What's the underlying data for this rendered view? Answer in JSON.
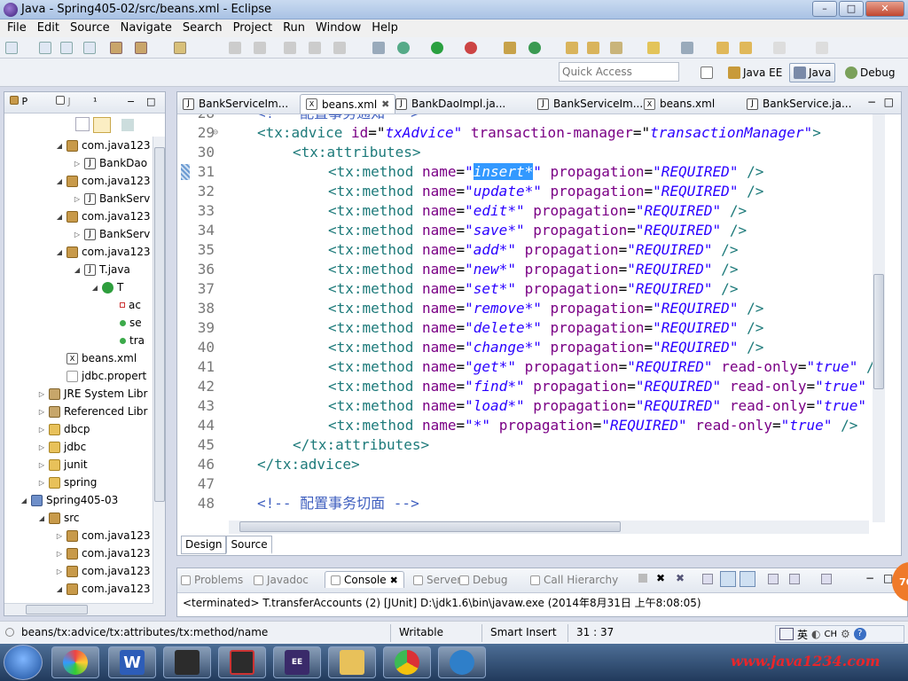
{
  "window": {
    "title": "Java - Spring405-02/src/beans.xml - Eclipse",
    "min": "–",
    "max": "□",
    "close": "✕"
  },
  "menu": [
    "File",
    "Edit",
    "Source",
    "Navigate",
    "Search",
    "Project",
    "Run",
    "Window",
    "Help"
  ],
  "quick_access": {
    "placeholder": "Quick Access"
  },
  "perspectives": [
    {
      "label": "Java EE",
      "active": false
    },
    {
      "label": "Java",
      "active": true
    },
    {
      "label": "Debug",
      "active": false
    }
  ],
  "explorer": {
    "tabs": [
      "P",
      "J",
      "¹"
    ],
    "tree": [
      {
        "label": "com.java123",
        "icon": "package-icon",
        "depth": 2,
        "twisty": "◢"
      },
      {
        "label": "BankDao",
        "icon": "java-file-icon",
        "depth": 3,
        "twisty": "▷"
      },
      {
        "label": "com.java123",
        "icon": "package-icon",
        "depth": 2,
        "twisty": "◢"
      },
      {
        "label": "BankServ",
        "icon": "java-file-icon",
        "depth": 3,
        "twisty": "▷"
      },
      {
        "label": "com.java123",
        "icon": "package-icon",
        "depth": 2,
        "twisty": "◢"
      },
      {
        "label": "BankServ",
        "icon": "java-file-icon",
        "depth": 3,
        "twisty": "▷"
      },
      {
        "label": "com.java123",
        "icon": "package-icon",
        "depth": 2,
        "twisty": "◢"
      },
      {
        "label": "T.java",
        "icon": "java-file-icon",
        "depth": 3,
        "twisty": "◢"
      },
      {
        "label": "T",
        "icon": "class-icon",
        "depth": 4,
        "twisty": "◢"
      },
      {
        "label": "ac",
        "icon": "field-private-icon",
        "depth": 5,
        "twisty": ""
      },
      {
        "label": "se",
        "icon": "method-public-icon",
        "depth": 5,
        "twisty": ""
      },
      {
        "label": "tra",
        "icon": "method-public-icon",
        "depth": 5,
        "twisty": ""
      },
      {
        "label": "beans.xml",
        "icon": "xml-file-icon",
        "depth": 2,
        "twisty": ""
      },
      {
        "label": "jdbc.propert",
        "icon": "properties-file-icon",
        "depth": 2,
        "twisty": ""
      },
      {
        "label": "JRE System Libr",
        "icon": "library-icon",
        "depth": 1,
        "twisty": "▷"
      },
      {
        "label": "Referenced Libr",
        "icon": "library-icon",
        "depth": 1,
        "twisty": "▷"
      },
      {
        "label": "dbcp",
        "icon": "folder-icon",
        "depth": 1,
        "twisty": "▷"
      },
      {
        "label": "jdbc",
        "icon": "folder-icon",
        "depth": 1,
        "twisty": "▷"
      },
      {
        "label": "junit",
        "icon": "folder-icon",
        "depth": 1,
        "twisty": "▷"
      },
      {
        "label": "spring",
        "icon": "folder-icon",
        "depth": 1,
        "twisty": "▷"
      },
      {
        "label": "Spring405-03",
        "icon": "project-icon",
        "depth": 0,
        "twisty": "◢"
      },
      {
        "label": "src",
        "icon": "source-folder-icon",
        "depth": 1,
        "twisty": "◢"
      },
      {
        "label": "com.java123",
        "icon": "package-icon",
        "depth": 2,
        "twisty": "▷"
      },
      {
        "label": "com.java123",
        "icon": "package-icon",
        "depth": 2,
        "twisty": "▷"
      },
      {
        "label": "com.java123",
        "icon": "package-icon",
        "depth": 2,
        "twisty": "▷"
      },
      {
        "label": "com.java123",
        "icon": "package-icon",
        "depth": 2,
        "twisty": "◢"
      }
    ]
  },
  "editor": {
    "tabs": [
      {
        "label": "BankServiceIm...",
        "icon": "java-file-icon",
        "active": false
      },
      {
        "label": "beans.xml",
        "icon": "xml-file-icon",
        "active": true
      },
      {
        "label": "BankDaoImpl.ja...",
        "icon": "java-file-icon",
        "active": false
      },
      {
        "label": "BankServiceIm...",
        "icon": "java-file-icon",
        "active": false
      },
      {
        "label": "beans.xml",
        "icon": "xml-file-icon",
        "active": false
      },
      {
        "label": "BankService.ja...",
        "icon": "java-file-icon",
        "active": false
      }
    ],
    "lines": [
      {
        "n": "28",
        "indent": 0,
        "kind": "comment",
        "text": "<!-- 配置事务通知 -->"
      },
      {
        "n": "29",
        "indent": 0,
        "kind": "open",
        "tag": "tx:advice",
        "attrs": [
          [
            "id",
            "txAdvice"
          ],
          [
            "transaction-manager",
            "transactionManager"
          ]
        ],
        "end": ">",
        "fold": true
      },
      {
        "n": "30",
        "indent": 1,
        "kind": "open",
        "tag": "tx:attributes",
        "attrs": [],
        "end": ">"
      },
      {
        "n": "31",
        "indent": 2,
        "kind": "method",
        "name": "insert*",
        "prop": "REQUIRED",
        "ro": "",
        "selected": true
      },
      {
        "n": "32",
        "indent": 2,
        "kind": "method",
        "name": "update*",
        "prop": "REQUIRED",
        "ro": ""
      },
      {
        "n": "33",
        "indent": 2,
        "kind": "method",
        "name": "edit*",
        "prop": "REQUIRED",
        "ro": ""
      },
      {
        "n": "34",
        "indent": 2,
        "kind": "method",
        "name": "save*",
        "prop": "REQUIRED",
        "ro": ""
      },
      {
        "n": "35",
        "indent": 2,
        "kind": "method",
        "name": "add*",
        "prop": "REQUIRED",
        "ro": ""
      },
      {
        "n": "36",
        "indent": 2,
        "kind": "method",
        "name": "new*",
        "prop": "REQUIRED",
        "ro": ""
      },
      {
        "n": "37",
        "indent": 2,
        "kind": "method",
        "name": "set*",
        "prop": "REQUIRED",
        "ro": ""
      },
      {
        "n": "38",
        "indent": 2,
        "kind": "method",
        "name": "remove*",
        "prop": "REQUIRED",
        "ro": ""
      },
      {
        "n": "39",
        "indent": 2,
        "kind": "method",
        "name": "delete*",
        "prop": "REQUIRED",
        "ro": ""
      },
      {
        "n": "40",
        "indent": 2,
        "kind": "method",
        "name": "change*",
        "prop": "REQUIRED",
        "ro": ""
      },
      {
        "n": "41",
        "indent": 2,
        "kind": "method",
        "name": "get*",
        "prop": "REQUIRED",
        "ro": "true"
      },
      {
        "n": "42",
        "indent": 2,
        "kind": "method",
        "name": "find*",
        "prop": "REQUIRED",
        "ro": "true"
      },
      {
        "n": "43",
        "indent": 2,
        "kind": "method",
        "name": "load*",
        "prop": "REQUIRED",
        "ro": "true"
      },
      {
        "n": "44",
        "indent": 2,
        "kind": "method",
        "name": "*",
        "prop": "REQUIRED",
        "ro": "true"
      },
      {
        "n": "45",
        "indent": 1,
        "kind": "close",
        "tag": "tx:attributes"
      },
      {
        "n": "46",
        "indent": 0,
        "kind": "close",
        "tag": "tx:advice"
      },
      {
        "n": "47",
        "indent": 0,
        "kind": "blank"
      },
      {
        "n": "48",
        "indent": 0,
        "kind": "comment",
        "text": "<!-- 配置事务切面 -->"
      }
    ],
    "design_tabs": [
      "Design",
      "Source"
    ]
  },
  "console": {
    "tabs": [
      {
        "label": "Problems",
        "active": false
      },
      {
        "label": "Javadoc",
        "active": false
      },
      {
        "label": "Console",
        "active": true
      },
      {
        "label": "Servers",
        "active": false
      },
      {
        "label": "Debug",
        "active": false
      },
      {
        "label": "Call Hierarchy",
        "active": false
      }
    ],
    "text": "<terminated> T.transferAccounts (2) [JUnit] D:\\jdk1.6\\bin\\javaw.exe (2014年8月31日 上午8:08:05)",
    "badge": "76"
  },
  "status": {
    "path": "beans/tx:advice/tx:attributes/tx:method/name",
    "writable": "Writable",
    "insert_mode": "Smart Insert",
    "position": "31 : 37",
    "ime": [
      "英",
      "CH"
    ]
  },
  "taskbar": {
    "site": "www.java1234.com"
  }
}
